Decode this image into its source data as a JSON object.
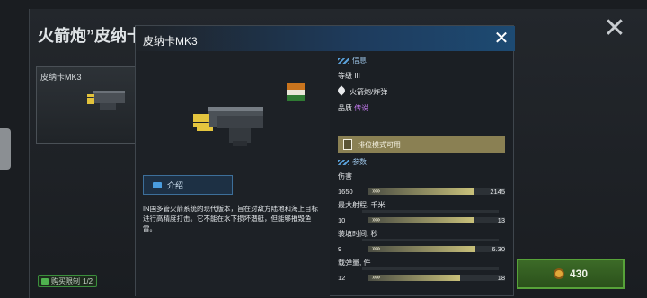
{
  "background": {
    "title": "火箭炮”皮纳卡",
    "card_label": "皮纳卡MK3",
    "limit_label": "购买限制",
    "limit_value": "1/2",
    "price": "430"
  },
  "modal": {
    "title": "皮纳卡MK3",
    "intro_button": "介绍",
    "description": "IN国多管火箭系统的现代版本，旨在对敌方陆地和海上目标进行高精度打击。它不能在水下损坏潜艇，但能够摧毁鱼雷。",
    "info": {
      "heading": "信息",
      "level_label": "等级",
      "level_value": "III",
      "type": "火箭炮/炸弹",
      "quality_label": "品质",
      "quality_value": "传说",
      "mode": "排位模式可用"
    },
    "params": {
      "heading": "参数",
      "stats": [
        {
          "name": "伤害",
          "current": "1650",
          "max": "2145",
          "fraction": 0.77
        },
        {
          "name": "最大射程, 千米",
          "current": "10",
          "max": "13",
          "fraction": 0.77
        },
        {
          "name": "装填时间, 秒",
          "current": "9",
          "max": "6.30",
          "fraction": 0.78
        },
        {
          "name": "载弹量, 件",
          "current": "12",
          "max": "18",
          "fraction": 0.67
        }
      ]
    }
  },
  "colors": {
    "accent_blue": "#1d4a72",
    "legend_purple": "#c77cf3",
    "price_green": "#3c6a27",
    "bar_gold": "#c8c07a"
  }
}
